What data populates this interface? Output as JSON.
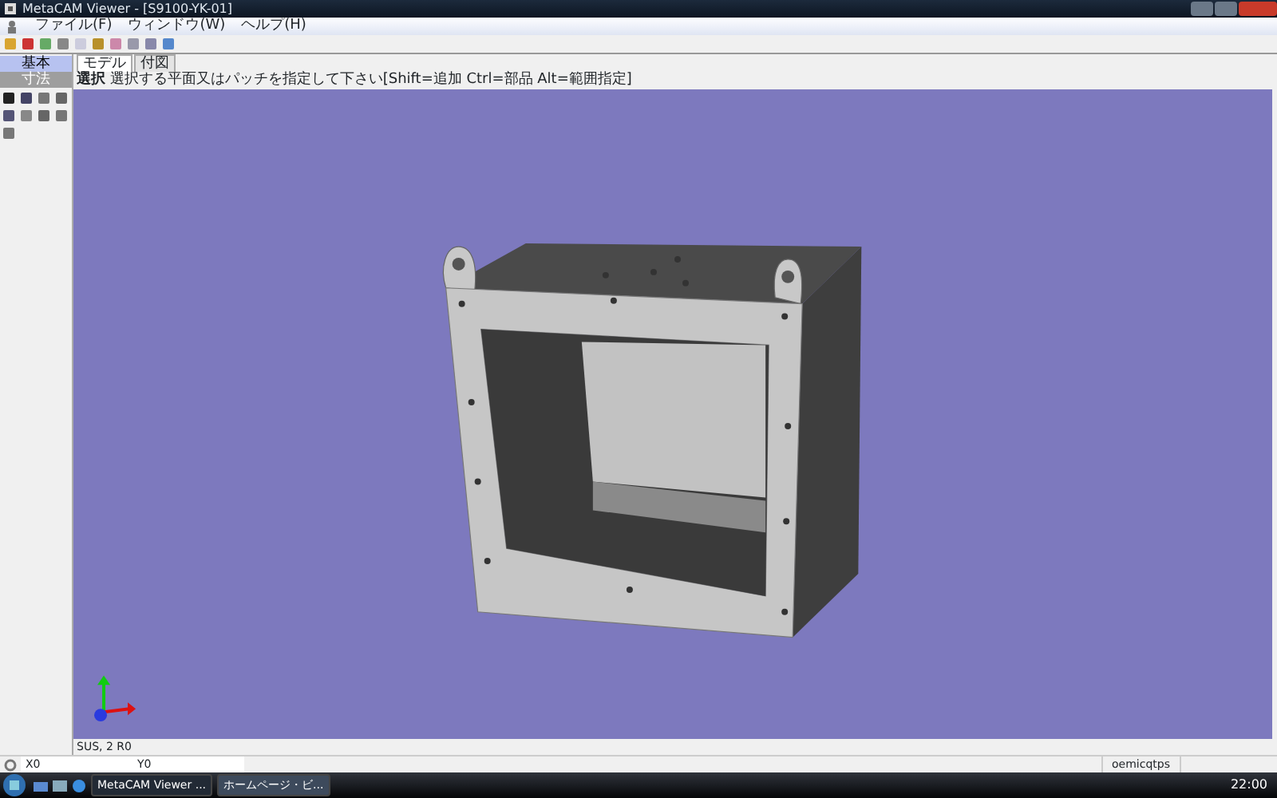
{
  "window": {
    "title": "MetaCAM Viewer - [S9100-YK-01]"
  },
  "menu": [
    {
      "label": "ファイル(F)"
    },
    {
      "label": "ウィンドウ(W)"
    },
    {
      "label": "ヘルプ(H)"
    }
  ],
  "side_tabs": [
    {
      "label": "基本",
      "selected": true
    },
    {
      "label": "寸法",
      "selected": false
    }
  ],
  "view_tabs": [
    {
      "label": "モデル",
      "selected": true
    },
    {
      "label": "付図",
      "selected": false
    }
  ],
  "hint": {
    "mode": "選択",
    "text": "選択する平面又はパッチを指定して下さい[Shift=追加 Ctrl=部品 Alt=範囲指定]"
  },
  "status": "SUS, 2 R0",
  "coords": {
    "x": "X0",
    "y": "Y0"
  },
  "status_right": "oemicqtps",
  "taskbar": {
    "tasks": [
      {
        "label": "MetaCAM Viewer ...",
        "selected": true
      },
      {
        "label": "ホームページ・ビ...",
        "selected": false
      }
    ],
    "clock": "22:00"
  }
}
